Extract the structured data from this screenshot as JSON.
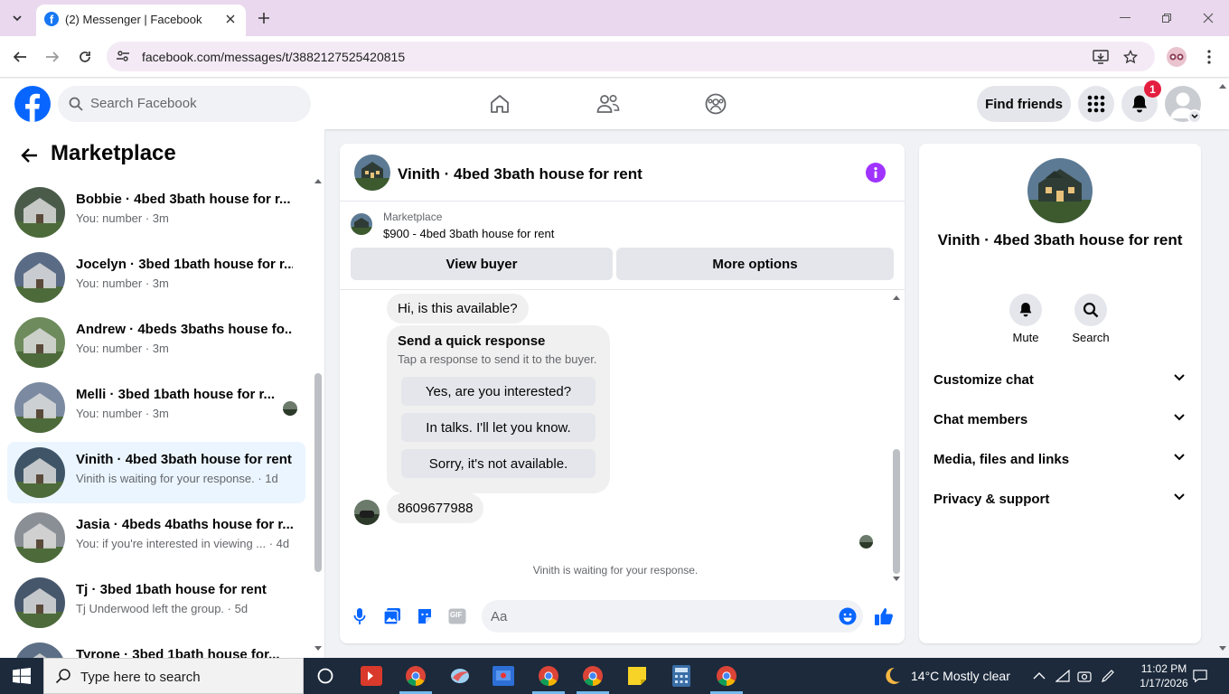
{
  "browser": {
    "tab_title": "(2) Messenger | Facebook",
    "url": "facebook.com/messages/t/3882127525420815"
  },
  "fb": {
    "search_placeholder": "Search Facebook",
    "find_friends": "Find friends",
    "notification_count": "1"
  },
  "left": {
    "title": "Marketplace",
    "conversations": [
      {
        "name": "Bobbie · 4bed 3bath house for r...",
        "sub": "You: number · 3m",
        "thumb_color": "#4a5b4a"
      },
      {
        "name": "Jocelyn · 3bed 1bath house for r...",
        "sub": "You: number · 3m",
        "thumb_color": "#5a6b85"
      },
      {
        "name": "Andrew · 4beds 3baths house fo...",
        "sub": "You: number · 3m",
        "thumb_color": "#6d8b5c"
      },
      {
        "name": "Melli · 3bed 1bath house for r...",
        "sub": "You: number · 3m",
        "thumb_color": "#7b8aa0"
      },
      {
        "name": "Vinith · 4bed 3bath house for rent",
        "sub": "Vinith is waiting for your response. · 1d",
        "thumb_color": "#3f5567"
      },
      {
        "name": "Jasia · 4beds 4baths house for r...",
        "sub": "You: if you're interested in viewing ... · 4d",
        "thumb_color": "#8a8f96"
      },
      {
        "name": "Tj · 3bed 1bath house for rent",
        "sub": "Tj Underwood left the group. · 5d",
        "thumb_color": "#46576c"
      },
      {
        "name": "Tyrone · 3bed 1bath house for...",
        "sub": "",
        "thumb_color": "#5c6f86"
      }
    ]
  },
  "chat": {
    "title": "Vinith · 4bed 3bath house for rent",
    "marketplace_label": "Marketplace",
    "listing": "$900 - 4bed 3bath house for rent",
    "view_buyer": "View buyer",
    "more_options": "More options",
    "msg_available": "Hi, is this available?",
    "quick_title": "Send a quick response",
    "quick_sub": "Tap a response to send it to the buyer.",
    "quick_responses": [
      "Yes, are you interested?",
      "In talks. I'll let you know.",
      "Sorry, it's not available."
    ],
    "msg_number": "8609677988",
    "waiting": "Vinith is waiting for your response.",
    "input_placeholder": "Aa",
    "gif_label": "GIF"
  },
  "right": {
    "name": "Vinith · 4bed 3bath house for rent",
    "mute": "Mute",
    "search": "Search",
    "sections": [
      "Customize chat",
      "Chat members",
      "Media, files and links",
      "Privacy & support"
    ]
  },
  "taskbar": {
    "search_placeholder": "Type here to search",
    "weather": "14°C  Mostly clear",
    "time": "11:02 PM",
    "date": "1/17/2026"
  },
  "colors": {
    "fb_blue": "#0866ff",
    "messenger_purple": "#a033ff",
    "active_row": "#ebf5ff",
    "badge_red": "#e41e3f"
  }
}
